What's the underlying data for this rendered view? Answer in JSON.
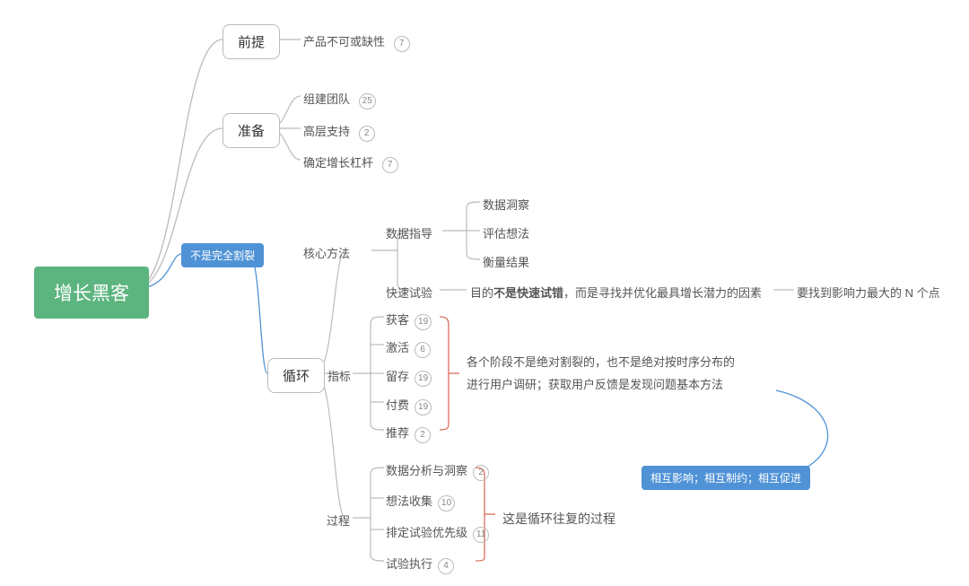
{
  "root": "增长黑客",
  "branches": {
    "premise": {
      "label": "前提",
      "items": [
        {
          "label": "产品不可或缺性",
          "count": 7
        }
      ]
    },
    "prepare": {
      "label": "准备",
      "items": [
        {
          "label": "组建团队",
          "count": 25
        },
        {
          "label": "高层支持",
          "count": 2
        },
        {
          "label": "确定增长杠杆",
          "count": 7
        }
      ]
    },
    "loop": {
      "label": "循环",
      "edge_note": "不是完全割裂",
      "core": {
        "label": "核心方法",
        "data_driven": {
          "label": "数据指导",
          "items": [
            "数据洞察",
            "评估想法",
            "衡量结果"
          ]
        },
        "fast_test": {
          "label": "快速试验",
          "detail_prefix": "目的",
          "detail_bold": "不是快速试错",
          "detail_suffix": "，而是寻找并优化最具增长潜力的因素",
          "detail_right": "要找到影响力最大的 N 个点"
        }
      },
      "metrics": {
        "label": "指标",
        "items": [
          {
            "label": "获客",
            "count": 19
          },
          {
            "label": "激活",
            "count": 6
          },
          {
            "label": "留存",
            "count": 19
          },
          {
            "label": "付费",
            "count": 19
          },
          {
            "label": "推荐",
            "count": 2
          }
        ],
        "group_note_line1": "各个阶段不是绝对割裂的，也不是绝对按时序分布的",
        "group_note_line2": "进行用户调研；获取用户反馈是发现问题基本方法",
        "group_tag": "相互影响；相互制约；相互促进"
      },
      "process": {
        "label": "过程",
        "items": [
          {
            "label": "数据分析与洞察",
            "count": 2
          },
          {
            "label": "想法收集",
            "count": 10
          },
          {
            "label": "排定试验优先级",
            "count": 11
          },
          {
            "label": "试验执行",
            "count": 4
          }
        ],
        "group_note": "这是循环往复的过程"
      }
    }
  }
}
